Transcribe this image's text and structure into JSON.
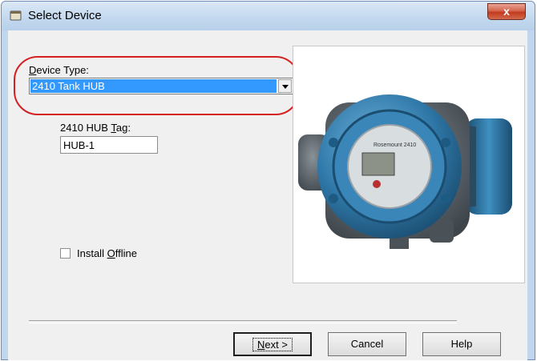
{
  "window": {
    "title": "Select Device",
    "close_label": "x"
  },
  "form": {
    "device_type_label_underline": "D",
    "device_type_label_rest": "evice Type:",
    "device_type_value": "2410 Tank HUB",
    "hub_tag_label_prefix": "2410 HUB ",
    "hub_tag_label_underline": "T",
    "hub_tag_label_suffix": "ag:",
    "hub_tag_value": "HUB-1",
    "install_offline_prefix": "Install ",
    "install_offline_underline": "O",
    "install_offline_suffix": "ffline",
    "install_offline_checked": false
  },
  "device_image": {
    "brand_text": "Rosemount 2410",
    "accent_color": "#2f78a8"
  },
  "buttons": {
    "next_underline": "N",
    "next_rest": "ext >",
    "cancel_label": "Cancel",
    "help_label": "Help"
  }
}
